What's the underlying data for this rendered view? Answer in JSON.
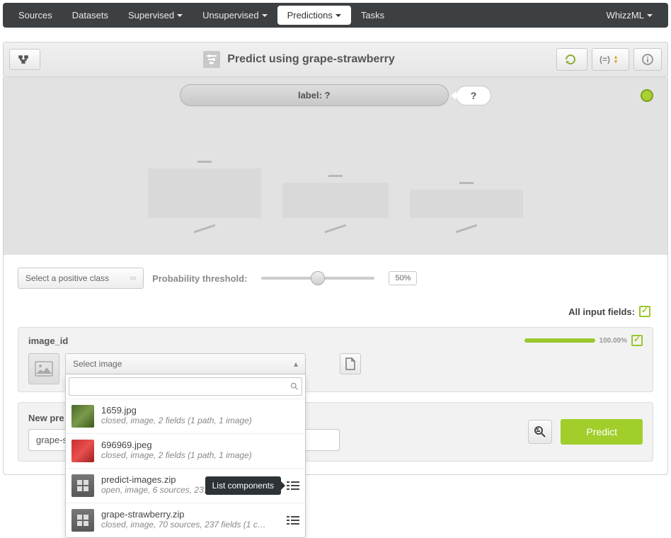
{
  "nav": {
    "items": [
      "Sources",
      "Datasets",
      "Supervised",
      "Unsupervised",
      "Predictions",
      "Tasks"
    ],
    "has_dropdown": [
      false,
      false,
      true,
      true,
      true,
      false
    ],
    "active_index": 4,
    "right_label": "WhizzML"
  },
  "toolbar": {
    "title": "Predict using grape-strawberry",
    "title_icon": "filter-icon"
  },
  "label_bar": {
    "text": "label: ?",
    "question": "?"
  },
  "threshold": {
    "select_placeholder": "Select a positive class",
    "label": "Probability threshold:",
    "value_pct": "50%"
  },
  "all_fields_label": "All input fields:",
  "field": {
    "label": "image_id",
    "percent": "100.00%",
    "dropdown_placeholder": "Select image",
    "search_value": "",
    "items": [
      {
        "title": "1659.jpg",
        "sub": "closed, image, 2 fields (1 path, 1 image)",
        "kind": "grapes"
      },
      {
        "title": "696969.jpeg",
        "sub": "closed, image, 2 fields (1 path, 1 image)",
        "kind": "straw"
      },
      {
        "title": "predict-images.zip",
        "sub": "open, image, 6 sources, 23…",
        "kind": "zip",
        "list_icon": true,
        "tooltip": "List components"
      },
      {
        "title": "grape-strawberry.zip",
        "sub": "closed, image, 70 sources, 237 fields (1 c…",
        "kind": "zip",
        "list_icon": true
      }
    ]
  },
  "prediction": {
    "label": "New pre",
    "input_value": "grape-s",
    "button": "Predict"
  }
}
